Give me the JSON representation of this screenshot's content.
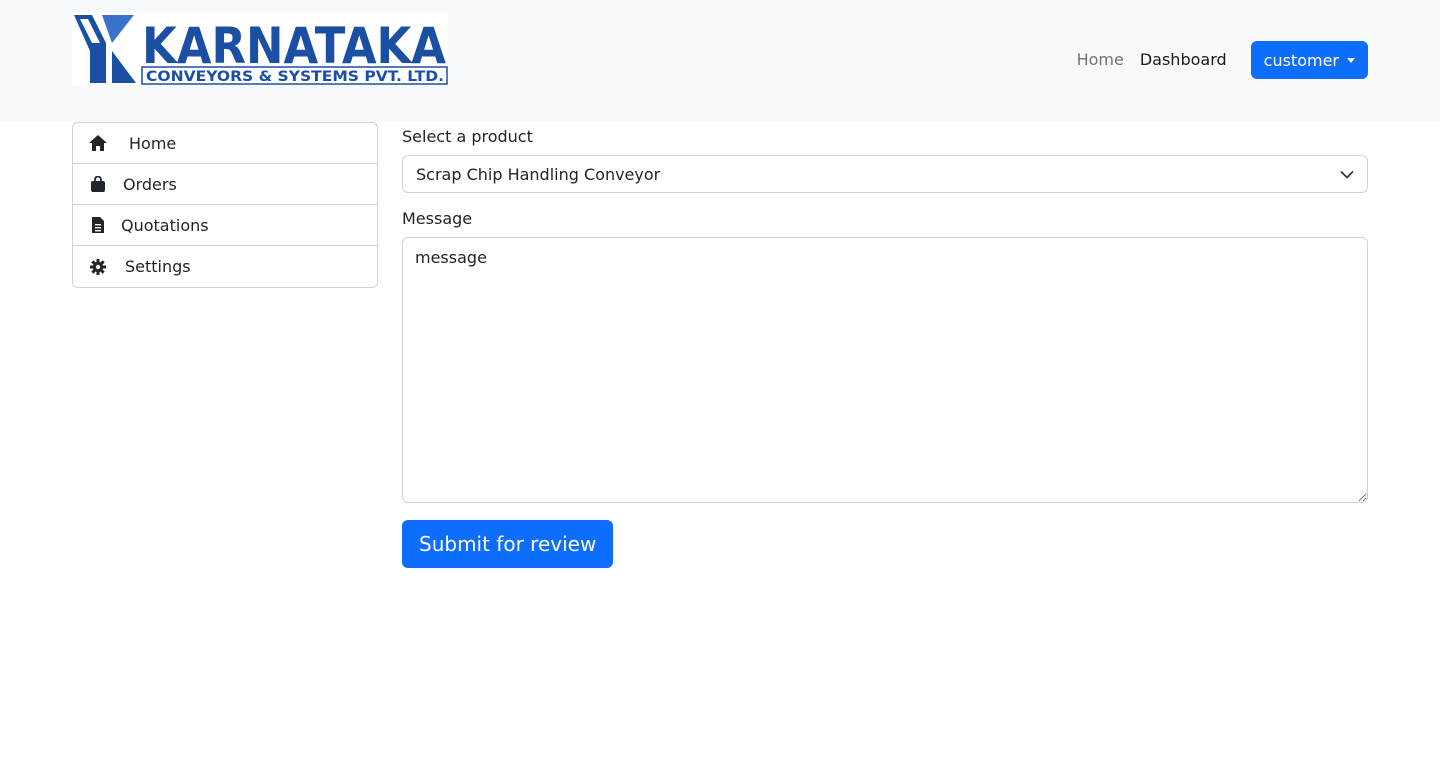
{
  "brand": {
    "name": "KARNATAKA",
    "tagline": "CONVEYORS & SYSTEMS PVT. LTD.",
    "colors": {
      "primary": "#1b4fa3",
      "accent": "#3a72c9"
    }
  },
  "nav": {
    "links": [
      {
        "label": "Home",
        "state": "muted"
      },
      {
        "label": "Dashboard",
        "state": "active"
      }
    ],
    "user_menu": {
      "label": "customer",
      "icon": "caret-down-icon"
    }
  },
  "sidebar": {
    "items": [
      {
        "label": "Home",
        "icon": "home-icon"
      },
      {
        "label": "Orders",
        "icon": "shopping-bag-icon"
      },
      {
        "label": "Quotations",
        "icon": "document-icon"
      },
      {
        "label": "Settings",
        "icon": "gear-icon"
      }
    ]
  },
  "form": {
    "product_label": "Select a product",
    "product_selected": "Scrap Chip Handling Conveyor",
    "message_label": "Message",
    "message_value": "message",
    "submit_label": "Submit for review"
  },
  "colors": {
    "accent": "#0d6efd",
    "navbar_bg": "#f8f9fa"
  }
}
